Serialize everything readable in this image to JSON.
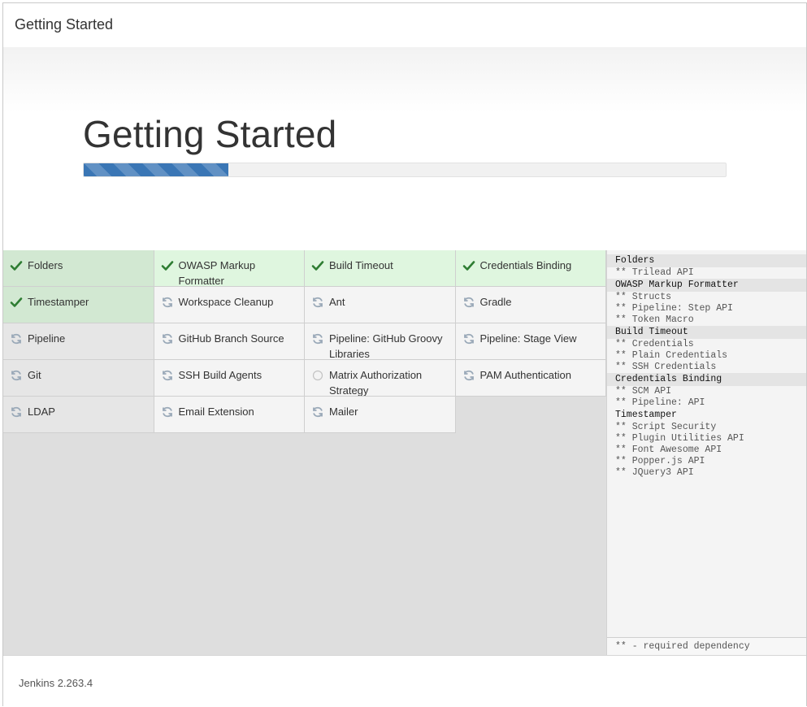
{
  "header": {
    "title": "Getting Started"
  },
  "hero": {
    "title": "Getting Started",
    "progress_percent": 22.5
  },
  "colors": {
    "accent": "#3a76b5",
    "success": "#2e7d32",
    "pending": "#9aa9b8"
  },
  "plugins": [
    {
      "name": "Folders",
      "status": "success",
      "icon": "check-icon"
    },
    {
      "name": "OWASP Markup Formatter",
      "status": "success",
      "icon": "check-icon"
    },
    {
      "name": "Build Timeout",
      "status": "success",
      "icon": "check-icon"
    },
    {
      "name": "Credentials Binding",
      "status": "success",
      "icon": "check-icon"
    },
    {
      "name": "Timestamper",
      "status": "success",
      "icon": "check-icon"
    },
    {
      "name": "Workspace Cleanup",
      "status": "installing",
      "icon": "refresh-icon"
    },
    {
      "name": "Ant",
      "status": "installing",
      "icon": "refresh-icon"
    },
    {
      "name": "Gradle",
      "status": "installing",
      "icon": "refresh-icon"
    },
    {
      "name": "Pipeline",
      "status": "installing",
      "icon": "refresh-icon"
    },
    {
      "name": "GitHub Branch Source",
      "status": "installing",
      "icon": "refresh-icon"
    },
    {
      "name": "Pipeline: GitHub Groovy Libraries",
      "status": "installing",
      "icon": "refresh-icon"
    },
    {
      "name": "Pipeline: Stage View",
      "status": "installing",
      "icon": "refresh-icon"
    },
    {
      "name": "Git",
      "status": "installing",
      "icon": "refresh-icon"
    },
    {
      "name": "SSH Build Agents",
      "status": "installing",
      "icon": "refresh-icon"
    },
    {
      "name": "Matrix Authorization Strategy",
      "status": "pending",
      "icon": "circle-icon"
    },
    {
      "name": "PAM Authentication",
      "status": "installing",
      "icon": "refresh-icon"
    },
    {
      "name": "LDAP",
      "status": "installing",
      "icon": "refresh-icon"
    },
    {
      "name": "Email Extension",
      "status": "installing",
      "icon": "refresh-icon"
    },
    {
      "name": "Mailer",
      "status": "installing",
      "icon": "refresh-icon"
    }
  ],
  "dependencies": [
    {
      "title": "Folders",
      "shaded": true,
      "items": [
        "** Trilead API"
      ]
    },
    {
      "title": "OWASP Markup Formatter",
      "shaded": true,
      "items": [
        "** Structs",
        "** Pipeline: Step API",
        "** Token Macro"
      ]
    },
    {
      "title": "Build Timeout",
      "shaded": true,
      "items": [
        "** Credentials",
        "** Plain Credentials",
        "** SSH Credentials"
      ]
    },
    {
      "title": "Credentials Binding",
      "shaded": true,
      "items": [
        "** SCM API",
        "** Pipeline: API"
      ]
    },
    {
      "title": "Timestamper",
      "shaded": false,
      "items": [
        "** Script Security",
        "** Plugin Utilities API",
        "** Font Awesome API",
        "** Popper.js API",
        "** JQuery3 API"
      ]
    }
  ],
  "deps_footer": "** - required dependency",
  "footer": {
    "version": "Jenkins 2.263.4"
  }
}
